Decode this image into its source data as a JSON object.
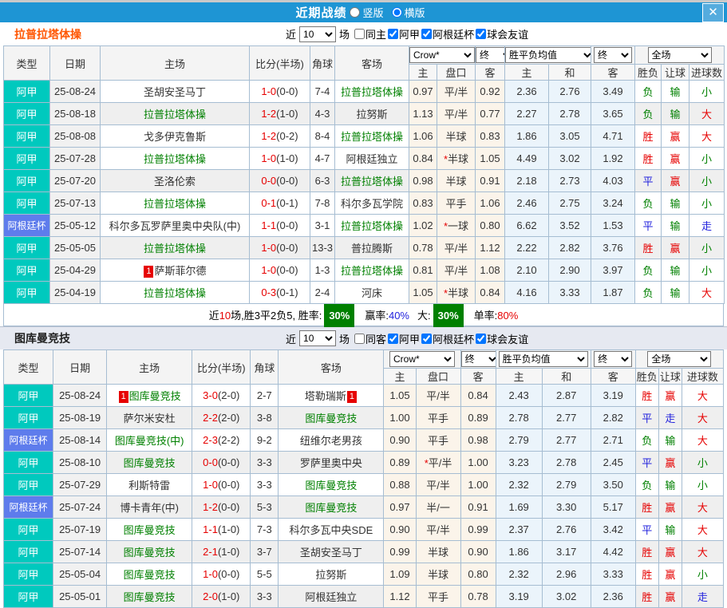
{
  "titlebar": {
    "title": "近期战绩",
    "radios": [
      {
        "label": "竖版",
        "checked": false
      },
      {
        "label": "横版",
        "checked": true
      }
    ],
    "close_glyph": "✕"
  },
  "colors": {
    "titlebar_blue": "#1E95D4",
    "league_jia_cyan": "#00C9BE",
    "league_cup_blue": "#5E7CEC",
    "team_green": "#008000",
    "win_red": "#E60000",
    "draw_blue": "#2222DD",
    "lose_green": "#008000",
    "rate_badge_green": "#008000",
    "section1_title_orange": "#FF5500"
  },
  "header": {
    "col_type": "类型",
    "col_date": "日期",
    "col_home": "主场",
    "col_score": "比分(半场)",
    "col_corner": "角球",
    "col_away": "客场",
    "sel_crow": "Crow*",
    "sel_fin1": "终",
    "sel_avg": "胜平负均值",
    "sel_fin2": "终",
    "sel_full": "全场",
    "subcols": [
      "主",
      "盘口",
      "客",
      "主",
      "和",
      "客",
      "胜负",
      "让球",
      "进球数"
    ]
  },
  "sections": [
    {
      "team": "拉普拉塔体操",
      "filter": {
        "near": "近",
        "count": "10",
        "unit": "场",
        "checks": [
          {
            "label": "同主",
            "checked": false
          },
          {
            "label": "阿甲",
            "checked": true
          },
          {
            "label": "阿根廷杯",
            "checked": true
          },
          {
            "label": "球会友谊",
            "checked": true
          }
        ]
      },
      "rows": [
        {
          "league": "阿甲",
          "cup": false,
          "date": "25-08-24",
          "home": "圣胡安圣马丁",
          "home_green": false,
          "home_badge": "",
          "score": "1-0",
          "half": "(0-0)",
          "corner": "7-4",
          "away": "拉普拉塔体操",
          "away_green": true,
          "away_badge": "",
          "o1": "0.97",
          "hcp": "平/半",
          "hcp_star": false,
          "o2": "0.92",
          "a1": "2.36",
          "a2": "2.76",
          "a3": "3.49",
          "r1": "负",
          "r1c": "g",
          "r2": "输",
          "r2c": "g",
          "r3": "小",
          "r3c": "g"
        },
        {
          "league": "阿甲",
          "cup": false,
          "date": "25-08-18",
          "home": "拉普拉塔体操",
          "home_green": true,
          "home_badge": "",
          "score": "1-2",
          "half": "(1-0)",
          "corner": "4-3",
          "away": "拉努斯",
          "away_green": false,
          "away_badge": "",
          "o1": "1.13",
          "hcp": "平/半",
          "hcp_star": false,
          "o2": "0.77",
          "a1": "2.27",
          "a2": "2.78",
          "a3": "3.65",
          "r1": "负",
          "r1c": "g",
          "r2": "输",
          "r2c": "g",
          "r3": "大",
          "r3c": "r"
        },
        {
          "league": "阿甲",
          "cup": false,
          "date": "25-08-08",
          "home": "戈多伊克鲁斯",
          "home_green": false,
          "home_badge": "",
          "score": "1-2",
          "half": "(0-2)",
          "corner": "8-4",
          "away": "拉普拉塔体操",
          "away_green": true,
          "away_badge": "",
          "o1": "1.06",
          "hcp": "半球",
          "hcp_star": false,
          "o2": "0.83",
          "a1": "1.86",
          "a2": "3.05",
          "a3": "4.71",
          "r1": "胜",
          "r1c": "r",
          "r2": "赢",
          "r2c": "r",
          "r3": "大",
          "r3c": "r"
        },
        {
          "league": "阿甲",
          "cup": false,
          "date": "25-07-28",
          "home": "拉普拉塔体操",
          "home_green": true,
          "home_badge": "",
          "score": "1-0",
          "half": "(1-0)",
          "corner": "4-7",
          "away": "阿根廷独立",
          "away_green": false,
          "away_badge": "",
          "o1": "0.84",
          "hcp": "半球",
          "hcp_star": true,
          "o2": "1.05",
          "a1": "4.49",
          "a2": "3.02",
          "a3": "1.92",
          "r1": "胜",
          "r1c": "r",
          "r2": "赢",
          "r2c": "r",
          "r3": "小",
          "r3c": "g"
        },
        {
          "league": "阿甲",
          "cup": false,
          "date": "25-07-20",
          "home": "圣洛伦索",
          "home_green": false,
          "home_badge": "",
          "score": "0-0",
          "half": "(0-0)",
          "corner": "6-3",
          "away": "拉普拉塔体操",
          "away_green": true,
          "away_badge": "",
          "o1": "0.98",
          "hcp": "半球",
          "hcp_star": false,
          "o2": "0.91",
          "a1": "2.18",
          "a2": "2.73",
          "a3": "4.03",
          "r1": "平",
          "r1c": "b",
          "r2": "赢",
          "r2c": "r",
          "r3": "小",
          "r3c": "g"
        },
        {
          "league": "阿甲",
          "cup": false,
          "date": "25-07-13",
          "home": "拉普拉塔体操",
          "home_green": true,
          "home_badge": "",
          "score": "0-1",
          "half": "(0-1)",
          "corner": "7-8",
          "away": "科尔多瓦学院",
          "away_green": false,
          "away_badge": "",
          "o1": "0.83",
          "hcp": "平手",
          "hcp_star": false,
          "o2": "1.06",
          "a1": "2.46",
          "a2": "2.75",
          "a3": "3.24",
          "r1": "负",
          "r1c": "g",
          "r2": "输",
          "r2c": "g",
          "r3": "小",
          "r3c": "g"
        },
        {
          "league": "阿根廷杯",
          "cup": true,
          "date": "25-05-12",
          "home": "科尔多瓦罗萨里奥中央队(中)",
          "home_green": false,
          "home_badge": "",
          "score": "1-1",
          "half": "(0-0)",
          "corner": "3-1",
          "away": "拉普拉塔体操",
          "away_green": true,
          "away_badge": "",
          "o1": "1.02",
          "hcp": "一球",
          "hcp_star": true,
          "o2": "0.80",
          "a1": "6.62",
          "a2": "3.52",
          "a3": "1.53",
          "r1": "平",
          "r1c": "b",
          "r2": "输",
          "r2c": "g",
          "r3": "走",
          "r3c": "b"
        },
        {
          "league": "阿甲",
          "cup": false,
          "date": "25-05-05",
          "home": "拉普拉塔体操",
          "home_green": true,
          "home_badge": "",
          "score": "1-0",
          "half": "(0-0)",
          "corner": "13-3",
          "away": "普拉腾斯",
          "away_green": false,
          "away_badge": "",
          "o1": "0.78",
          "hcp": "平/半",
          "hcp_star": false,
          "o2": "1.12",
          "a1": "2.22",
          "a2": "2.82",
          "a3": "3.76",
          "r1": "胜",
          "r1c": "r",
          "r2": "赢",
          "r2c": "r",
          "r3": "小",
          "r3c": "g"
        },
        {
          "league": "阿甲",
          "cup": false,
          "date": "25-04-29",
          "home": "萨斯菲尔德",
          "home_green": false,
          "home_badge": "1",
          "score": "1-0",
          "half": "(0-0)",
          "corner": "1-3",
          "away": "拉普拉塔体操",
          "away_green": true,
          "away_badge": "",
          "o1": "0.81",
          "hcp": "平/半",
          "hcp_star": false,
          "o2": "1.08",
          "a1": "2.10",
          "a2": "2.90",
          "a3": "3.97",
          "r1": "负",
          "r1c": "g",
          "r2": "输",
          "r2c": "g",
          "r3": "小",
          "r3c": "g"
        },
        {
          "league": "阿甲",
          "cup": false,
          "date": "25-04-19",
          "home": "拉普拉塔体操",
          "home_green": true,
          "home_badge": "",
          "score": "0-3",
          "half": "(0-1)",
          "corner": "2-4",
          "away": "河床",
          "away_green": false,
          "away_badge": "",
          "o1": "1.05",
          "hcp": "半球",
          "hcp_star": true,
          "o2": "0.84",
          "a1": "4.16",
          "a2": "3.33",
          "a3": "1.87",
          "r1": "负",
          "r1c": "g",
          "r2": "输",
          "r2c": "g",
          "r3": "大",
          "r3c": "r"
        }
      ],
      "summary": {
        "pre": "近",
        "n": "10",
        "mid1": "场,胜3平2负5, 胜率:",
        "rate1": "30%",
        "lbl2": "赢率:",
        "rate2": "40%",
        "lbl3": "大:",
        "rate3": "30%",
        "lbl4": "单率:",
        "rate4": "80%"
      }
    },
    {
      "team": "图库曼竞技",
      "filter": {
        "near": "近",
        "count": "10",
        "unit": "场",
        "checks": [
          {
            "label": "同客",
            "checked": false
          },
          {
            "label": "阿甲",
            "checked": true
          },
          {
            "label": "阿根廷杯",
            "checked": true
          },
          {
            "label": "球会友谊",
            "checked": true
          }
        ]
      },
      "rows": [
        {
          "league": "阿甲",
          "cup": false,
          "date": "25-08-24",
          "home": "图库曼竞技",
          "home_green": true,
          "home_badge": "1",
          "score": "3-0",
          "half": "(2-0)",
          "corner": "2-7",
          "away": "塔勒瑞斯",
          "away_green": false,
          "away_badge": "1",
          "o1": "1.05",
          "hcp": "平/半",
          "hcp_star": false,
          "o2": "0.84",
          "a1": "2.43",
          "a2": "2.87",
          "a3": "3.19",
          "r1": "胜",
          "r1c": "r",
          "r2": "赢",
          "r2c": "r",
          "r3": "大",
          "r3c": "r"
        },
        {
          "league": "阿甲",
          "cup": false,
          "date": "25-08-19",
          "home": "萨尔米安杜",
          "home_green": false,
          "home_badge": "",
          "score": "2-2",
          "half": "(2-0)",
          "corner": "3-8",
          "away": "图库曼竞技",
          "away_green": true,
          "away_badge": "",
          "o1": "1.00",
          "hcp": "平手",
          "hcp_star": false,
          "o2": "0.89",
          "a1": "2.78",
          "a2": "2.77",
          "a3": "2.82",
          "r1": "平",
          "r1c": "b",
          "r2": "走",
          "r2c": "b",
          "r3": "大",
          "r3c": "r"
        },
        {
          "league": "阿根廷杯",
          "cup": true,
          "date": "25-08-14",
          "home": "图库曼竞技(中)",
          "home_green": true,
          "home_badge": "",
          "score": "2-3",
          "half": "(2-2)",
          "corner": "9-2",
          "away": "纽维尔老男孩",
          "away_green": false,
          "away_badge": "",
          "o1": "0.90",
          "hcp": "平手",
          "hcp_star": false,
          "o2": "0.98",
          "a1": "2.79",
          "a2": "2.77",
          "a3": "2.71",
          "r1": "负",
          "r1c": "g",
          "r2": "输",
          "r2c": "g",
          "r3": "大",
          "r3c": "r"
        },
        {
          "league": "阿甲",
          "cup": false,
          "date": "25-08-10",
          "home": "图库曼竞技",
          "home_green": true,
          "home_badge": "",
          "score": "0-0",
          "half": "(0-0)",
          "corner": "3-3",
          "away": "罗萨里奥中央",
          "away_green": false,
          "away_badge": "",
          "o1": "0.89",
          "hcp": "平/半",
          "hcp_star": true,
          "o2": "1.00",
          "a1": "3.23",
          "a2": "2.78",
          "a3": "2.45",
          "r1": "平",
          "r1c": "b",
          "r2": "赢",
          "r2c": "r",
          "r3": "小",
          "r3c": "g"
        },
        {
          "league": "阿甲",
          "cup": false,
          "date": "25-07-29",
          "home": "利斯特雷",
          "home_green": false,
          "home_badge": "",
          "score": "1-0",
          "half": "(0-0)",
          "corner": "3-3",
          "away": "图库曼竞技",
          "away_green": true,
          "away_badge": "",
          "o1": "0.88",
          "hcp": "平/半",
          "hcp_star": false,
          "o2": "1.00",
          "a1": "2.32",
          "a2": "2.79",
          "a3": "3.50",
          "r1": "负",
          "r1c": "g",
          "r2": "输",
          "r2c": "g",
          "r3": "小",
          "r3c": "g"
        },
        {
          "league": "阿根廷杯",
          "cup": true,
          "date": "25-07-24",
          "home": "博卡青年(中)",
          "home_green": false,
          "home_badge": "",
          "score": "1-2",
          "half": "(0-0)",
          "corner": "5-3",
          "away": "图库曼竞技",
          "away_green": true,
          "away_badge": "",
          "o1": "0.97",
          "hcp": "半/一",
          "hcp_star": false,
          "o2": "0.91",
          "a1": "1.69",
          "a2": "3.30",
          "a3": "5.17",
          "r1": "胜",
          "r1c": "r",
          "r2": "赢",
          "r2c": "r",
          "r3": "大",
          "r3c": "r"
        },
        {
          "league": "阿甲",
          "cup": false,
          "date": "25-07-19",
          "home": "图库曼竞技",
          "home_green": true,
          "home_badge": "",
          "score": "1-1",
          "half": "(1-0)",
          "corner": "7-3",
          "away": "科尔多瓦中央SDE",
          "away_green": false,
          "away_badge": "",
          "o1": "0.90",
          "hcp": "平/半",
          "hcp_star": false,
          "o2": "0.99",
          "a1": "2.37",
          "a2": "2.76",
          "a3": "3.42",
          "r1": "平",
          "r1c": "b",
          "r2": "输",
          "r2c": "g",
          "r3": "大",
          "r3c": "r"
        },
        {
          "league": "阿甲",
          "cup": false,
          "date": "25-07-14",
          "home": "图库曼竞技",
          "home_green": true,
          "home_badge": "",
          "score": "2-1",
          "half": "(1-0)",
          "corner": "3-7",
          "away": "圣胡安圣马丁",
          "away_green": false,
          "away_badge": "",
          "o1": "0.99",
          "hcp": "半球",
          "hcp_star": false,
          "o2": "0.90",
          "a1": "1.86",
          "a2": "3.17",
          "a3": "4.42",
          "r1": "胜",
          "r1c": "r",
          "r2": "赢",
          "r2c": "r",
          "r3": "大",
          "r3c": "r"
        },
        {
          "league": "阿甲",
          "cup": false,
          "date": "25-05-04",
          "home": "图库曼竞技",
          "home_green": true,
          "home_badge": "",
          "score": "1-0",
          "half": "(0-0)",
          "corner": "5-5",
          "away": "拉努斯",
          "away_green": false,
          "away_badge": "",
          "o1": "1.09",
          "hcp": "半球",
          "hcp_star": false,
          "o2": "0.80",
          "a1": "2.32",
          "a2": "2.96",
          "a3": "3.33",
          "r1": "胜",
          "r1c": "r",
          "r2": "赢",
          "r2c": "r",
          "r3": "小",
          "r3c": "g"
        },
        {
          "league": "阿甲",
          "cup": false,
          "date": "25-05-01",
          "home": "图库曼竞技",
          "home_green": true,
          "home_badge": "",
          "score": "2-0",
          "half": "(1-0)",
          "corner": "3-3",
          "away": "阿根廷独立",
          "away_green": false,
          "away_badge": "",
          "o1": "1.12",
          "hcp": "平手",
          "hcp_star": false,
          "o2": "0.78",
          "a1": "3.19",
          "a2": "3.02",
          "a3": "2.36",
          "r1": "胜",
          "r1c": "r",
          "r2": "赢",
          "r2c": "r",
          "r3": "走",
          "r3c": "b"
        }
      ]
    }
  ]
}
